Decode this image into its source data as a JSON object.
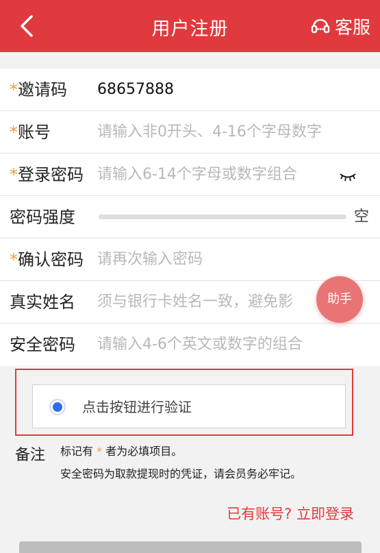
{
  "header": {
    "title": "用户注册",
    "service_label": "客服"
  },
  "form": {
    "required_mark": "*",
    "invite_code": {
      "label": "邀请码",
      "value": "68657888"
    },
    "account": {
      "label": "账号",
      "placeholder": "请输入非0开头、4-16个字母数字"
    },
    "login_password": {
      "label": "登录密码",
      "placeholder": "请输入6-14个字母或数字组合"
    },
    "password_strength": {
      "label": "密码强度",
      "value": "空",
      "level": 0
    },
    "confirm_password": {
      "label": "确认密码",
      "placeholder": "请再次输入密码"
    },
    "real_name": {
      "label": "真实姓名",
      "placeholder": "须与银行卡姓名一致，避免影"
    },
    "safe_password": {
      "label": "安全密码",
      "placeholder": "请输入4-6个英文或数字的组合"
    }
  },
  "helper_label": "助手",
  "verify": {
    "label": "点击按钮进行验证",
    "accent": "#2f6fe8"
  },
  "notes": {
    "label": "备注",
    "line1_prefix": "标记有",
    "line1_mark": "*",
    "line1_suffix": "者为必填项目。",
    "line2": "安全密码为取款提现时的凭证，请会员务必牢记。"
  },
  "login_link": "已有账号? 立即登录",
  "colors": {
    "brand": "#e03a3e",
    "required": "#e8a23a",
    "link": "#e23a3a"
  },
  "icons": {
    "back": "chevron-left-icon",
    "service": "headset-icon",
    "eye": "eye-closed-icon",
    "radio": "radio-selected-icon"
  }
}
